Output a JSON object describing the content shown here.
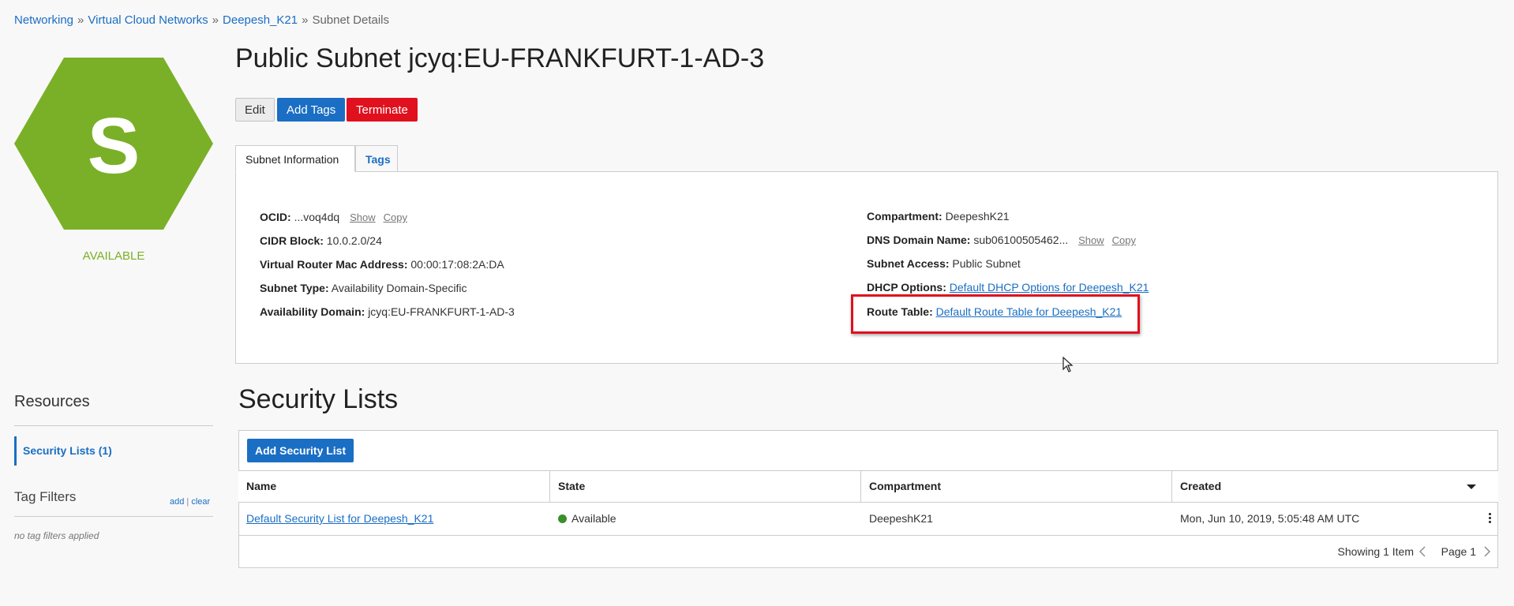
{
  "breadcrumb": {
    "items": [
      "Networking",
      "Virtual Cloud Networks",
      "Deepesh_K21"
    ],
    "current": "Subnet Details",
    "separator": "»"
  },
  "resource_icon": {
    "letter": "S",
    "status": "AVAILABLE",
    "color": "#7ab027"
  },
  "header": {
    "title": "Public Subnet jcyq:EU-FRANKFURT-1-AD-3",
    "buttons": {
      "edit": "Edit",
      "add_tags": "Add Tags",
      "terminate": "Terminate"
    }
  },
  "tabs": {
    "info": "Subnet Information",
    "tags": "Tags"
  },
  "info": {
    "ocid": {
      "label": "OCID:",
      "value": "...voq4dq",
      "show": "Show",
      "copy": "Copy"
    },
    "cidr": {
      "label": "CIDR Block:",
      "value": "10.0.2.0/24"
    },
    "mac": {
      "label": "Virtual Router Mac Address:",
      "value": "00:00:17:08:2A:DA"
    },
    "subnet_type": {
      "label": "Subnet Type:",
      "value": "Availability Domain-Specific"
    },
    "ad": {
      "label": "Availability Domain:",
      "value": "jcyq:EU-FRANKFURT-1-AD-3"
    },
    "compartment": {
      "label": "Compartment:",
      "value": "DeepeshK21"
    },
    "dns": {
      "label": "DNS Domain Name:",
      "value": "sub06100505462...",
      "show": "Show",
      "copy": "Copy"
    },
    "access": {
      "label": "Subnet Access:",
      "value": "Public Subnet"
    },
    "dhcp": {
      "label": "DHCP Options:",
      "value": "Default DHCP Options for Deepesh_K21"
    },
    "route": {
      "label": "Route Table:",
      "value": "Default Route Table for Deepesh_K21"
    }
  },
  "sidebar": {
    "resources_title": "Resources",
    "items": [
      {
        "label": "Security Lists (1)"
      }
    ],
    "tag_filters_title": "Tag Filters",
    "tag_add": "add",
    "tag_sep": "|",
    "tag_clear": "clear",
    "no_filters": "no tag filters applied"
  },
  "security_lists": {
    "title": "Security Lists",
    "add_button": "Add Security List",
    "columns": [
      "Name",
      "State",
      "Compartment",
      "Created"
    ],
    "rows": [
      {
        "name": "Default Security List for Deepesh_K21",
        "state": "Available",
        "compartment": "DeepeshK21",
        "created": "Mon, Jun 10, 2019, 5:05:48 AM UTC"
      }
    ],
    "showing": "Showing 1 Item",
    "page": "Page 1"
  },
  "colors": {
    "accent": "#1a6ec4",
    "danger": "#e0101e",
    "available": "#3a8f2b",
    "hexagon": "#7ab027"
  }
}
